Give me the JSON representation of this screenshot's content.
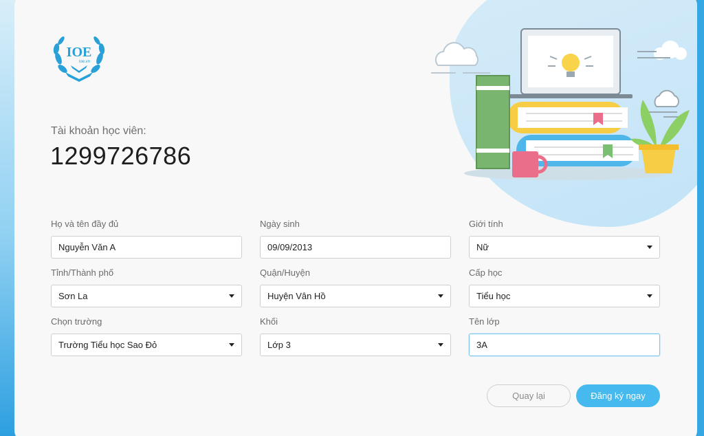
{
  "logo": {
    "text": "IOE",
    "subtext": "ioe.vn"
  },
  "account": {
    "label": "Tài khoản học viên:",
    "number": "1299726786"
  },
  "form": {
    "full_name": {
      "label": "Họ và tên đầy đủ",
      "value": "Nguyễn Văn A"
    },
    "birth_date": {
      "label": "Ngày sinh",
      "value": "09/09/2013"
    },
    "gender": {
      "label": "Giới tính",
      "value": "Nữ"
    },
    "province": {
      "label": "Tỉnh/Thành phố",
      "value": "Sơn La"
    },
    "district": {
      "label": "Quận/Huyện",
      "value": "Huyện Vân Hồ"
    },
    "school_level": {
      "label": "Cấp học",
      "value": "Tiểu học"
    },
    "school": {
      "label": "Chọn trường",
      "value": "Trường Tiểu học Sao Đỏ"
    },
    "grade": {
      "label": "Khối",
      "value": "Lớp 3"
    },
    "class_name": {
      "label": "Tên lớp",
      "value": "3A"
    }
  },
  "buttons": {
    "back": "Quay lại",
    "register": "Đăng ký ngay"
  },
  "colors": {
    "primary": "#46b9ee",
    "background": "#35a8e4",
    "card": "#f8f8f8"
  }
}
